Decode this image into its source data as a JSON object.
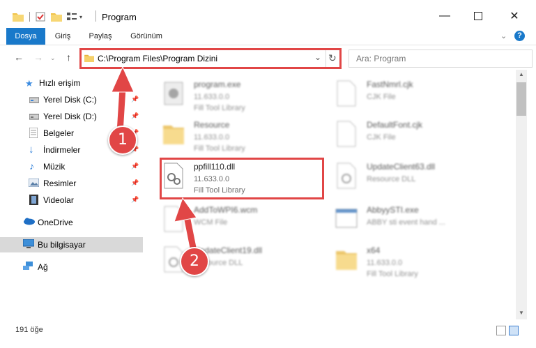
{
  "window": {
    "title": "Program"
  },
  "ribbon": {
    "tabs": [
      "Dosya",
      "Giriş",
      "Paylaş",
      "Görünüm"
    ]
  },
  "address": {
    "path": "C:\\Program Files\\Program Dizini"
  },
  "search": {
    "placeholder": "Ara: Program"
  },
  "sidebar": {
    "quick_access": "Hızlı erişim",
    "items": [
      "Yerel Disk (C:)",
      "Yerel Disk (D:)",
      "Belgeler",
      "İndirmeler",
      "Müzik",
      "Resimler",
      "Videolar"
    ],
    "onedrive": "OneDrive",
    "this_pc": "Bu bilgisayar",
    "network": "Ağ"
  },
  "files": [
    {
      "name": "program.exe",
      "line2": "11.633.0.0",
      "line3": "Fill Tool Library"
    },
    {
      "name": "FastNmrl.cjk",
      "line2": "CJK File",
      "line3": ""
    },
    {
      "name": "Resource",
      "line2": "11.633.0.0",
      "line3": "Fill Tool Library"
    },
    {
      "name": "DefaultFont.cjk",
      "line2": "CJK File",
      "line3": ""
    },
    {
      "name": "ppfill110.dll",
      "line2": "11.633.0.0",
      "line3": "Fill Tool Library"
    },
    {
      "name": "UpdateClient63.dll",
      "line2": "Resource DLL",
      "line3": ""
    },
    {
      "name": "AddToWPI6.wcm",
      "line2": "WCM File",
      "line3": ""
    },
    {
      "name": "AbbyySTI.exe",
      "line2": "ABBY sti event hand ...",
      "line3": ""
    },
    {
      "name": "UpdateClient19.dll",
      "line2": "Resource DLL",
      "line3": ""
    },
    {
      "name": "x64",
      "line2": "11.633.0.0",
      "line3": "Fill Tool Library"
    }
  ],
  "status": {
    "count": "191 öğe"
  },
  "callouts": [
    "1",
    "2"
  ]
}
